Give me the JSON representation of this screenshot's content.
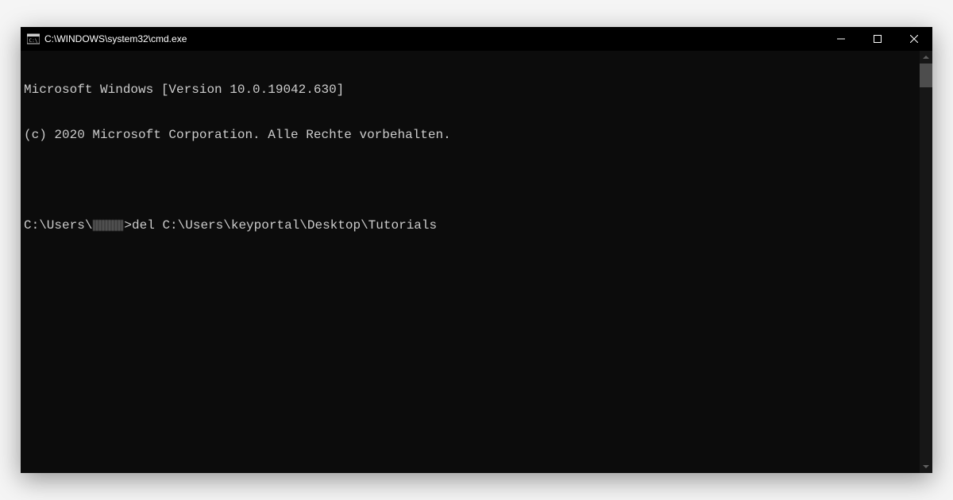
{
  "window": {
    "title": "C:\\WINDOWS\\system32\\cmd.exe"
  },
  "terminal": {
    "line1": "Microsoft Windows [Version 10.0.19042.630]",
    "line2": "(c) 2020 Microsoft Corporation. Alle Rechte vorbehalten.",
    "prompt_prefix": "C:\\Users\\",
    "prompt_suffix": ">",
    "command": "del C:\\Users\\keyportal\\Desktop\\Tutorials"
  }
}
